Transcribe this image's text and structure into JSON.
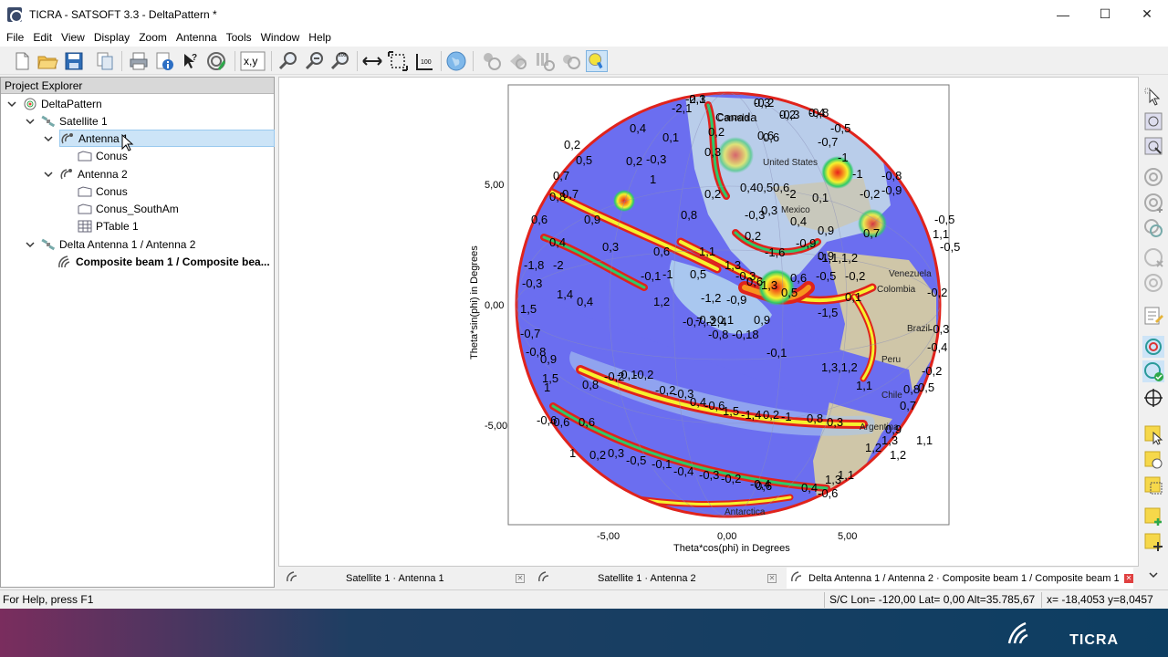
{
  "window": {
    "title": "TICRA - SATSOFT 3.3  - DeltaPattern *",
    "minimize_glyph": "—",
    "maximize_glyph": "☐",
    "close_glyph": "✕"
  },
  "menu": [
    "File",
    "Edit",
    "View",
    "Display",
    "Zoom",
    "Antenna",
    "Tools",
    "Window",
    "Help"
  ],
  "toolbar": {
    "xy_label": "x,y",
    "icons": [
      "new-file-icon",
      "open-folder-icon",
      "save-icon",
      "copy-icon",
      "print-icon",
      "info-icon",
      "help-pointer-icon",
      "antenna-pattern-icon",
      "coordinates-icon",
      "zoom-in-icon",
      "zoom-out-icon",
      "zoom-100-icon",
      "fit-width-icon",
      "fit-box-icon",
      "scale-100-icon",
      "globe-icon",
      "grayed-tool-1-icon",
      "grayed-tool-2-icon",
      "grayed-tool-3-icon",
      "grayed-tool-4-icon",
      "highlight-tool-icon"
    ]
  },
  "explorer": {
    "title": "Project Explorer",
    "items": [
      {
        "label": "DeltaPattern",
        "level": 0,
        "expanded": true,
        "icon": "project-icon",
        "bold": false,
        "selected": false
      },
      {
        "label": "Satellite 1",
        "level": 1,
        "expanded": true,
        "icon": "satellite-icon",
        "bold": false,
        "selected": false
      },
      {
        "label": "Antenna 1",
        "level": 2,
        "expanded": true,
        "icon": "antenna-icon",
        "bold": false,
        "selected": true
      },
      {
        "label": "Conus",
        "level": 3,
        "icon": "coverage-polygon-icon",
        "bold": false,
        "selected": false
      },
      {
        "label": "Antenna 2",
        "level": 2,
        "expanded": true,
        "icon": "antenna-icon",
        "bold": false,
        "selected": false
      },
      {
        "label": "Conus",
        "level": 3,
        "icon": "coverage-polygon-icon",
        "bold": false,
        "selected": false
      },
      {
        "label": "Conus_SouthAm",
        "level": 3,
        "icon": "coverage-polygon-icon",
        "bold": false,
        "selected": false
      },
      {
        "label": "PTable 1",
        "level": 3,
        "icon": "table-icon",
        "bold": false,
        "selected": false
      },
      {
        "label": "Delta Antenna 1 / Antenna 2",
        "level": 1,
        "expanded": true,
        "icon": "satellite-icon",
        "bold": false,
        "selected": false
      },
      {
        "label": "Composite beam 1 / Composite bea...",
        "level": 2,
        "icon": "composite-beam-icon",
        "bold": true,
        "selected": false
      }
    ]
  },
  "plot": {
    "xlabel": "Theta*cos(phi) in Degrees",
    "ylabel": "Theta*sin(phi) in Degrees",
    "xticks": [
      "-5,00",
      "0,00",
      "5,00"
    ],
    "yticks": [
      "5,00",
      "0,00",
      "-5,00"
    ],
    "places": [
      "Canada",
      "United States",
      "Mexico",
      "Venezuela",
      "Colombia",
      "Brazil",
      "Peru",
      "Chile",
      "Argentina",
      "Antarctica"
    ],
    "contour_labels": [
      "-2,3",
      "-0,2",
      "-0,3",
      "0,4",
      "-0,5",
      "-2,1",
      "Canada",
      "0,4",
      "0,1",
      "0,2",
      "0,6",
      "0,6",
      "-0,7",
      "0,2",
      "0,3",
      "-1",
      "-0,8",
      "0,5",
      "0,2",
      "-1",
      "0,7",
      "-0,3",
      "0,40,50,6",
      "0,1",
      "-0,2",
      "-0,9",
      "0,7",
      "1",
      "0,8",
      "-2",
      "0,8",
      "0,9",
      "0,2",
      "-0,3",
      "0,3",
      "0,4",
      "0,9",
      "0,7",
      "0,2",
      "-1,6",
      "-0,9",
      "0,9",
      "0,6",
      "0,4",
      "0,3",
      "0,6",
      "1,1",
      "-1,1,1,2",
      "1,1",
      "-0,1",
      "-1",
      "0,5",
      "1,3",
      "-0,3",
      "0,6",
      "1,3",
      "0,6",
      "-0,5",
      "-0,2",
      "-1,8",
      "-2",
      "-0,3",
      "1,4",
      "0,4",
      "1,2",
      "-1,2",
      "-0,9",
      "0,5",
      "-1,5",
      "0,1",
      "1,5",
      "0,9",
      "-0,7,-2,4",
      "-0,3",
      "0,1",
      "-0,8",
      "-0,18",
      "-0,1",
      "1,3,1,2",
      "1,1",
      "-0,7",
      "-0,8",
      "0,9",
      "1,5",
      "1",
      "0,8",
      "-0,2",
      "-0,1",
      "-0,2",
      "-0,2",
      "-0,3",
      "0,4",
      "-0,6",
      "1,5",
      "-1,4",
      "0,2",
      "-1",
      "0,8",
      "0,3",
      "-0,6",
      "-0,6",
      "0,6",
      "0,7",
      "0,8",
      "0,9",
      "1,1",
      "1,2",
      "1,3",
      "1",
      "0,2",
      "0,3",
      "-0,5",
      "-0,1",
      "-0,4",
      "-0,3",
      "-0,2",
      "-0,4",
      "0,6",
      "0,4",
      "-0,6",
      "1,1",
      "1,2",
      "1,3",
      "0,5",
      "-0,2",
      "-0,4",
      "-0,3",
      "-0,2",
      "-0,5",
      "-0,5",
      "-0,1",
      "0,3",
      "0,2",
      "-0,8"
    ]
  },
  "doctabs": [
    {
      "label": "Satellite 1 · Antenna 1",
      "icon": "antenna-icon",
      "active": false
    },
    {
      "label": "Satellite 1 · Antenna 2",
      "icon": "antenna-icon",
      "active": false
    },
    {
      "label": "Delta Antenna 1 / Antenna 2 · Composite beam 1 / Composite beam 1",
      "icon": "composite-beam-icon",
      "active": true
    }
  ],
  "status": {
    "help": "For Help, press F1",
    "sc": "S/C Lon= -120,00 Lat=  0,00 Alt=35.785,67",
    "cursor": "x= -18,4053 y=8,0457"
  },
  "footer": {
    "brand": "TICRA"
  },
  "colors": {
    "selection": "#cce4f7",
    "plot_background": "#6b6ef0",
    "heat_red": "#e0231c",
    "heat_yellow": "#f6f22e",
    "heat_green": "#2ec96a",
    "land": "#cfc6a8",
    "ocean_light": "#a9c7ef"
  }
}
